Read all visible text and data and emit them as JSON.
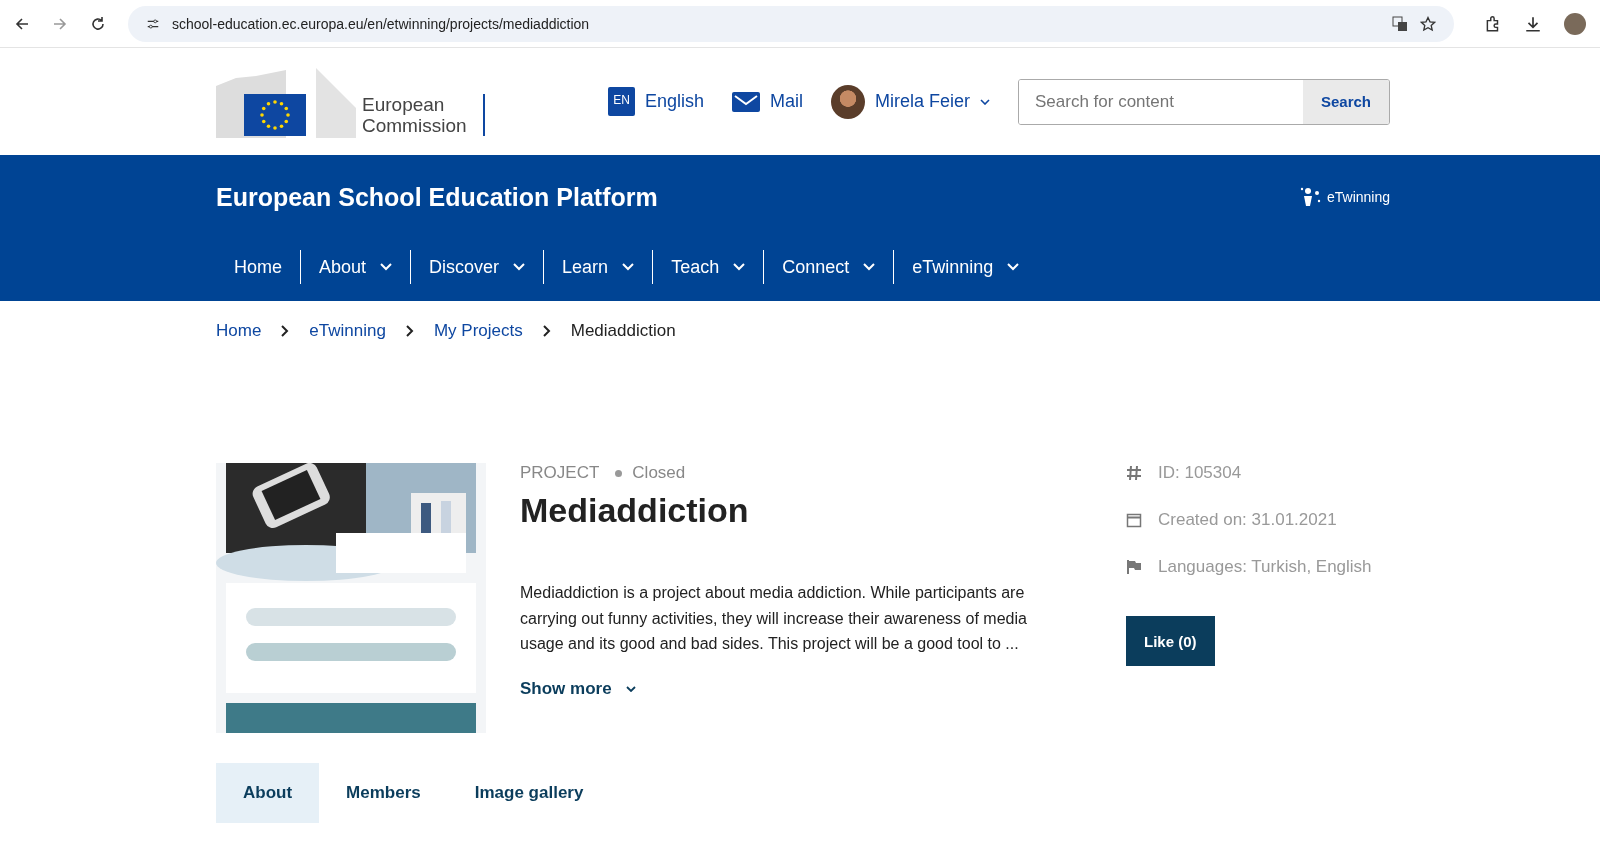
{
  "browser": {
    "url": "school-education.ec.europa.eu/en/etwinning/projects/mediaddiction"
  },
  "header": {
    "logo_text": [
      "European",
      "Commission"
    ],
    "language_code": "EN",
    "language": "English",
    "mail": "Mail",
    "user": "Mirela Feier",
    "search": {
      "placeholder": "Search for content",
      "button": "Search"
    }
  },
  "banner": {
    "title": "European School Education Platform",
    "brand": "eTwinning"
  },
  "nav": [
    {
      "label": "Home",
      "dropdown": false
    },
    {
      "label": "About",
      "dropdown": true
    },
    {
      "label": "Discover",
      "dropdown": true
    },
    {
      "label": "Learn",
      "dropdown": true
    },
    {
      "label": "Teach",
      "dropdown": true
    },
    {
      "label": "Connect",
      "dropdown": true
    },
    {
      "label": "eTwinning",
      "dropdown": true
    }
  ],
  "breadcrumb": [
    "Home",
    "eTwinning",
    "My Projects",
    "Mediaddiction"
  ],
  "project": {
    "type": "PROJECT",
    "status": "Closed",
    "title": "Mediaddiction",
    "description": "Mediaddiction is a project about media addiction. While participants are carrying out funny activities, they will increase their awareness of media usage and its good and bad sides. This project will be a good tool to ...",
    "show_more": "Show more",
    "meta": [
      {
        "kind": "id",
        "text": "ID: 105304"
      },
      {
        "kind": "date",
        "text": "Created on: 31.01.2021"
      },
      {
        "kind": "languages",
        "text": "Languages: Turkish, English"
      }
    ],
    "like": "Like (0)"
  },
  "tabs": [
    {
      "label": "About",
      "selected": true
    },
    {
      "label": "Members",
      "selected": false
    },
    {
      "label": "Image gallery",
      "selected": false
    }
  ]
}
